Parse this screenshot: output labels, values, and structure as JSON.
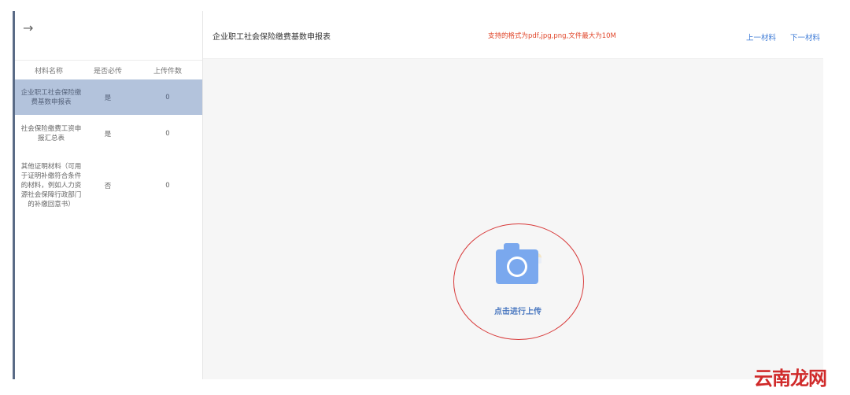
{
  "sidebar": {
    "columns": {
      "name": "材料名称",
      "required": "是否必传",
      "count": "上传件数"
    },
    "rows": [
      {
        "name": "企业职工社会保险缴费基数申报表",
        "required": "是",
        "count": "0",
        "active": true
      },
      {
        "name": "社会保险缴费工资申报汇总表",
        "required": "是",
        "count": "0",
        "active": false
      },
      {
        "name": "其他证明材料（可用于证明补缴符合条件的材料，例如人力资源社会保障行政部门的补缴回意书）",
        "required": "否",
        "count": "0",
        "active": false
      }
    ]
  },
  "header": {
    "title": "企业职工社会保险缴费基数申报表",
    "format_hint": "支持的格式为pdf,jpg,png,文件最大为10M",
    "prev_label": "上一材料",
    "next_label": "下一材料"
  },
  "upload": {
    "label": "点击进行上传",
    "icon": "camera-icon"
  },
  "watermark": "云南龙网",
  "colors": {
    "active_row": "#b3c3dc",
    "hint_red": "#e0462a",
    "link_blue": "#3e7bd6",
    "camera_blue": "#7aa8ee",
    "circle_red": "#d83a3a"
  }
}
